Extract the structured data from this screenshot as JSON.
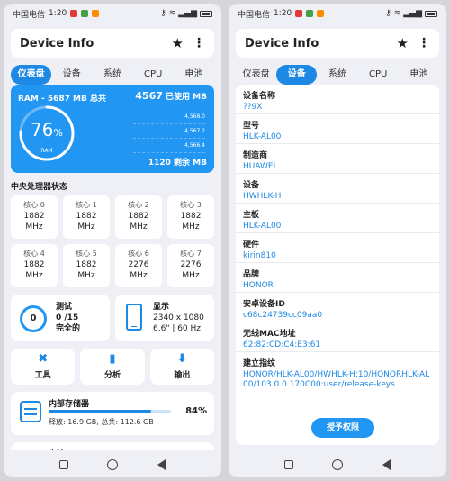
{
  "status": {
    "carrier": "中国电信",
    "time": "1:20"
  },
  "app": {
    "title": "Device Info"
  },
  "tabs": [
    "仪表盘",
    "设备",
    "系统",
    "CPU",
    "电池"
  ],
  "dashboard": {
    "ram": {
      "label": "RAM - 5687 MB 总共",
      "used_value": "4567",
      "used_suffix": "已使用 MB",
      "percent": "76",
      "percent_sign": "%",
      "gauge_label": "RAM",
      "percent_fraction": 0.76,
      "ticks": [
        "4,568.0",
        "4,567.2",
        "4,566.4"
      ],
      "free": "1120 剩余 MB"
    },
    "cpu_section": "中央处理器状态",
    "cores": [
      {
        "name": "核心 0",
        "freq": "1882",
        "unit": "MHz"
      },
      {
        "name": "核心 1",
        "freq": "1882",
        "unit": "MHz"
      },
      {
        "name": "核心 2",
        "freq": "1882",
        "unit": "MHz"
      },
      {
        "name": "核心 3",
        "freq": "1882",
        "unit": "MHz"
      },
      {
        "name": "核心 4",
        "freq": "1882",
        "unit": "MHz"
      },
      {
        "name": "核心 5",
        "freq": "1882",
        "unit": "MHz"
      },
      {
        "name": "核心 6",
        "freq": "2276",
        "unit": "MHz"
      },
      {
        "name": "核心 7",
        "freq": "2276",
        "unit": "MHz"
      }
    ],
    "test": {
      "value": "0",
      "title": "测试",
      "count": "0 /15",
      "status": "完全的"
    },
    "display": {
      "title": "显示",
      "resolution": "2340 x 1080",
      "detail": "6.6\" | 60 Hz"
    },
    "tools": [
      {
        "icon": "✖",
        "label": "工具"
      },
      {
        "icon": "▮",
        "label": "分析"
      },
      {
        "icon": "⬇",
        "label": "输出"
      }
    ],
    "storage": {
      "title": "内部存储器",
      "detail": "释放: 16.9 GB, 总共: 112.6 GB",
      "percent": "84%",
      "fraction": 0.84
    },
    "battery": {
      "title": "电池"
    }
  },
  "device": {
    "items": [
      {
        "key": "设备名称",
        "value": "??9X"
      },
      {
        "key": "型号",
        "value": "HLK-AL00"
      },
      {
        "key": "制造商",
        "value": "HUAWEI"
      },
      {
        "key": "设备",
        "value": "HWHLK-H"
      },
      {
        "key": "主板",
        "value": "HLK-AL00"
      },
      {
        "key": "硬件",
        "value": "kirin810"
      },
      {
        "key": "品牌",
        "value": "HONOR"
      },
      {
        "key": "安卓设备ID",
        "value": "c68c24739cc09aa0"
      },
      {
        "key": "无线MAC地址",
        "value": "62:82:CD:C4:E3:61"
      },
      {
        "key": "建立指纹",
        "value": "HONOR/HLK-AL00/HWHLK-H:10/HONORHLK-AL00/103.0.0.170C00:user/release-keys"
      }
    ],
    "grant_button": "授予权限"
  },
  "colors": {
    "accent": "#1e88e5",
    "ram_card": "#2196f3"
  }
}
